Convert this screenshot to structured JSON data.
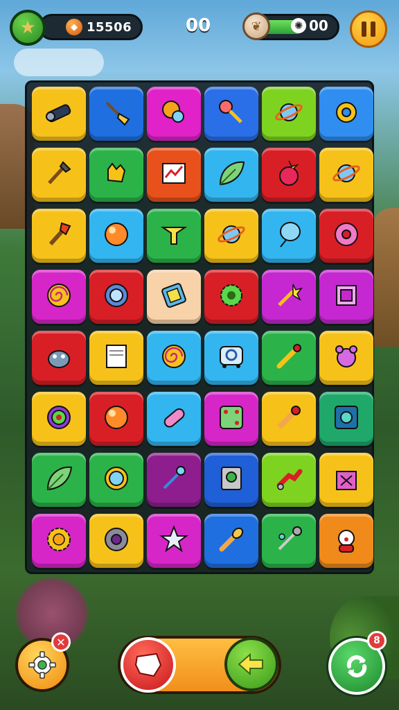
{
  "hud": {
    "coins": "15506",
    "moves": "00",
    "energy": "00",
    "energy_level": 0.55
  },
  "board": {
    "rows": 8,
    "columns": 6,
    "tiles": [
      [
        {
          "color": "#f6c21a",
          "icon": "telescope-icon"
        },
        {
          "color": "#1f6fe0",
          "icon": "broom-icon"
        },
        {
          "color": "#e022c8",
          "icon": "magnifier-sun-icon"
        },
        {
          "color": "#2a6fe8",
          "icon": "lollipop-icon"
        },
        {
          "color": "#7ed321",
          "icon": "planet-icon"
        },
        {
          "color": "#2f8ef0",
          "icon": "gear-icon"
        }
      ],
      [
        {
          "color": "#f6c21a",
          "icon": "brush-icon"
        },
        {
          "color": "#2bb34a",
          "icon": "glove-icon"
        },
        {
          "color": "#e8511c",
          "icon": "chart-icon"
        },
        {
          "color": "#33b5f0",
          "icon": "leaf-icon"
        },
        {
          "color": "#d81f26",
          "icon": "bomb-icon"
        },
        {
          "color": "#f6c21a",
          "icon": "planet-icon"
        }
      ],
      [
        {
          "color": "#f6c21a",
          "icon": "torch-icon"
        },
        {
          "color": "#33b5f0",
          "icon": "orb-icon"
        },
        {
          "color": "#2bb34a",
          "icon": "fountain-icon"
        },
        {
          "color": "#f6c21a",
          "icon": "planet-icon"
        },
        {
          "color": "#33b5f0",
          "icon": "balloon-icon"
        },
        {
          "color": "#d81f26",
          "icon": "donut-icon"
        }
      ],
      [
        {
          "color": "#d626c8",
          "icon": "spiral-icon"
        },
        {
          "color": "#d81f26",
          "icon": "portal-icon"
        },
        {
          "color": "#f8d2a8",
          "icon": "tablet-icon"
        },
        {
          "color": "#d81f26",
          "icon": "cog-green-icon"
        },
        {
          "color": "#c528d0",
          "icon": "wand-icon"
        },
        {
          "color": "#c528d0",
          "icon": "frame-icon"
        }
      ],
      [
        {
          "color": "#d81f26",
          "icon": "monster-icon"
        },
        {
          "color": "#f6c21a",
          "icon": "notepad-icon"
        },
        {
          "color": "#33b5f0",
          "icon": "spiral-icon"
        },
        {
          "color": "#33b5f0",
          "icon": "cart-icon"
        },
        {
          "color": "#2bb34a",
          "icon": "pin-icon"
        },
        {
          "color": "#f6c21a",
          "icon": "bear-orb-icon"
        }
      ],
      [
        {
          "color": "#f6c21a",
          "icon": "target-icon"
        },
        {
          "color": "#d81f26",
          "icon": "orb-icon"
        },
        {
          "color": "#33b5f0",
          "icon": "pill-icon"
        },
        {
          "color": "#d626c8",
          "icon": "dice-icon"
        },
        {
          "color": "#f6c21a",
          "icon": "pencil-icon"
        },
        {
          "color": "#1fa86a",
          "icon": "square-icon"
        }
      ],
      [
        {
          "color": "#2bb34a",
          "icon": "leaf-icon"
        },
        {
          "color": "#2bb34a",
          "icon": "mirror-icon"
        },
        {
          "color": "#8e1e8e",
          "icon": "scepter-icon"
        },
        {
          "color": "#1f5fd8",
          "icon": "device-icon"
        },
        {
          "color": "#7ed321",
          "icon": "pipe-icon"
        },
        {
          "color": "#f6c21a",
          "icon": "box-icon"
        }
      ],
      [
        {
          "color": "#d626c8",
          "icon": "sun-gear-icon"
        },
        {
          "color": "#f6c21a",
          "icon": "vault-icon"
        },
        {
          "color": "#d626c8",
          "icon": "star-icon"
        },
        {
          "color": "#1f6fe0",
          "icon": "microphone-icon"
        },
        {
          "color": "#2bb34a",
          "icon": "key-icon"
        },
        {
          "color": "#f08a1a",
          "icon": "clown-icon"
        }
      ]
    ]
  },
  "controls": {
    "settings_badge": "✕",
    "refresh_badge": "8"
  }
}
